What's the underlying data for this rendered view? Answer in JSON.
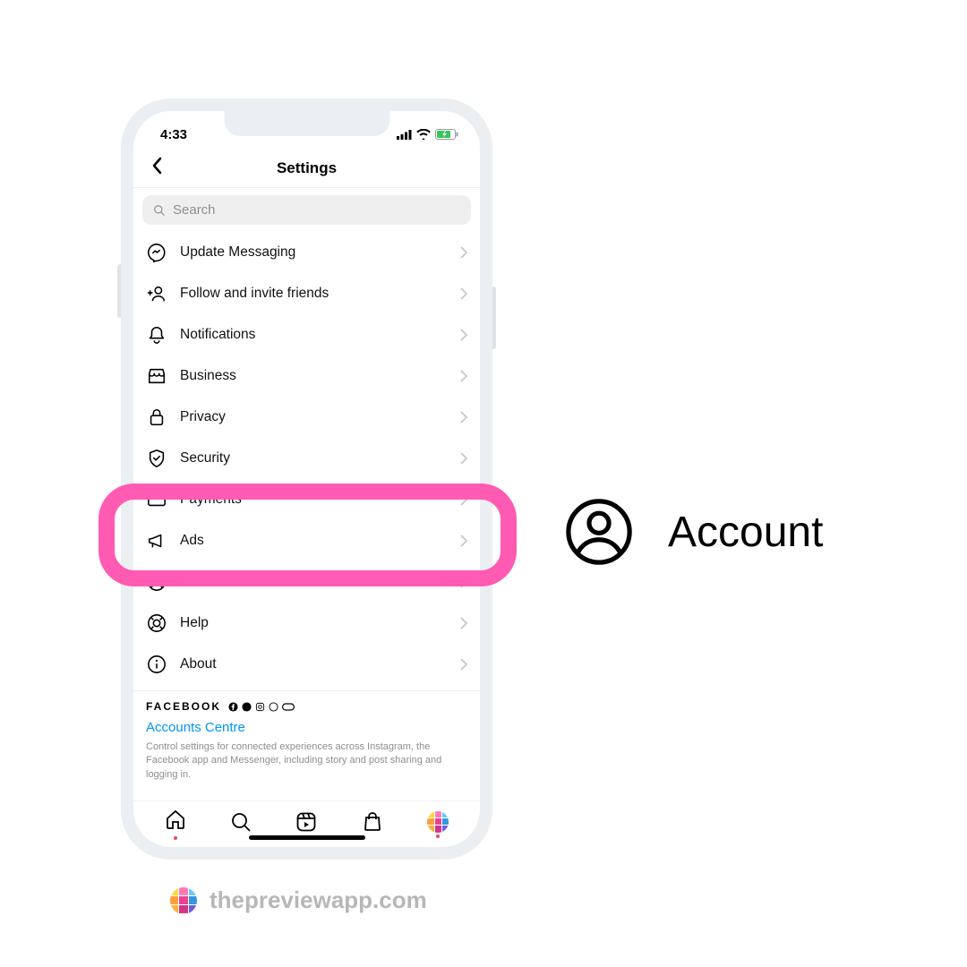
{
  "status": {
    "time": "4:33"
  },
  "nav": {
    "title": "Settings"
  },
  "search": {
    "placeholder": "Search"
  },
  "menu": {
    "items": [
      {
        "label": "Update Messaging"
      },
      {
        "label": "Follow and invite friends"
      },
      {
        "label": "Notifications"
      },
      {
        "label": "Business"
      },
      {
        "label": "Privacy"
      },
      {
        "label": "Security"
      },
      {
        "label": "Payments"
      },
      {
        "label": "Ads"
      },
      {
        "label": "Account"
      },
      {
        "label": "Help"
      },
      {
        "label": "About"
      }
    ]
  },
  "footer": {
    "brand": "FACEBOOK",
    "link": "Accounts Centre",
    "desc": "Control settings for connected experiences across Instagram, the Facebook app and Messenger, including story and post sharing and logging in."
  },
  "callout": {
    "label": "Account"
  },
  "watermark": {
    "text": "thepreviewapp.com"
  },
  "colors": {
    "highlight": "#ff5bb3",
    "link": "#0095f6",
    "logo": [
      "#ffd93b",
      "#ff7ab6",
      "#6ec6ff",
      "#ff9e3b",
      "#e84393",
      "#3498db",
      "#ffb33b",
      "#d63384",
      "#6c5ce7"
    ]
  }
}
